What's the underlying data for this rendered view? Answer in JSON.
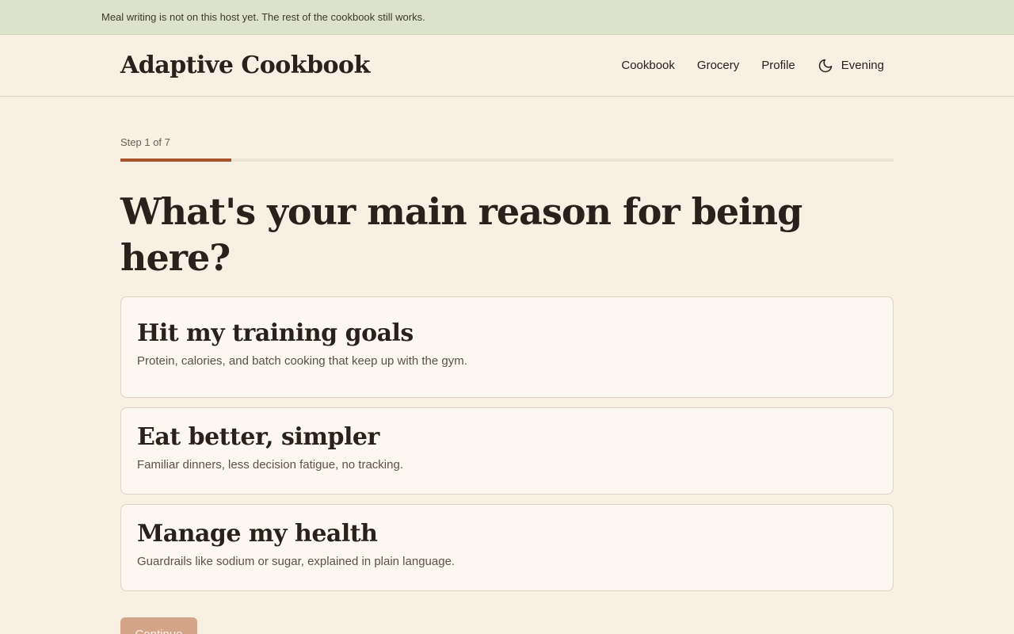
{
  "banner": {
    "message": "Meal writing is not on this host yet. The rest of the cookbook still works."
  },
  "header": {
    "app_title": "Adaptive Cookbook",
    "nav": [
      {
        "label": "Cookbook"
      },
      {
        "label": "Grocery"
      },
      {
        "label": "Profile"
      }
    ],
    "theme": {
      "label": "Evening",
      "icon": "moon-icon"
    }
  },
  "onboarding": {
    "step_label": "Step 1 of 7",
    "step_current": 1,
    "step_total": 7,
    "progress_fraction": 0.143,
    "question": "What's your main reason for being here?",
    "options": [
      {
        "title": "Hit my training goals",
        "description": "Protein, calories, and batch cooking that keep up with the gym."
      },
      {
        "title": "Eat better, simpler",
        "description": "Familiar dinners, less decision fatigue, no tracking."
      },
      {
        "title": "Manage my health",
        "description": "Guardrails like sodium or sugar, explained in plain language."
      }
    ],
    "continue_label": "Continue",
    "continue_enabled": false
  },
  "colors": {
    "background": "#f7f0e3",
    "banner": "#dde3c8",
    "accent": "#a9522c",
    "button_disabled": "#d4a488",
    "card": "#fcf8f1"
  }
}
